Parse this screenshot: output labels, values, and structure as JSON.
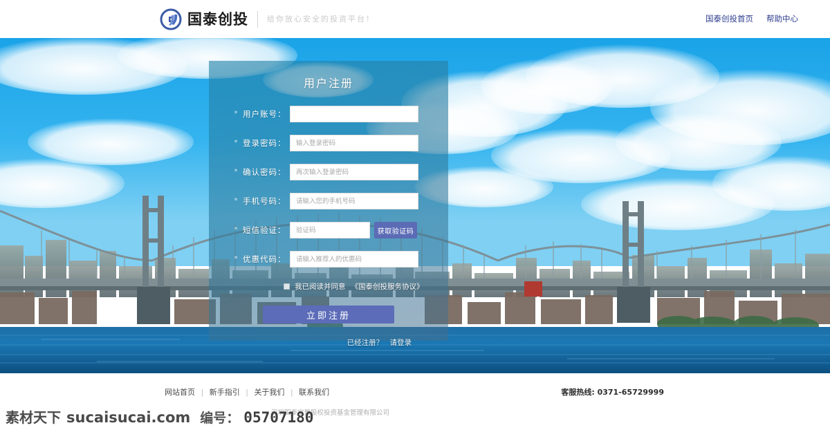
{
  "header": {
    "brand_name": "国泰创投",
    "tagline": "给你放心安全的投资平台！",
    "logo_icon": "gt-circle-logo-icon",
    "nav": [
      {
        "label": "国泰创投首页"
      },
      {
        "label": "帮助中心"
      }
    ]
  },
  "register": {
    "title": "用户注册",
    "required_mark": "*",
    "fields": [
      {
        "label": "用户账号：",
        "placeholder": "",
        "value": "",
        "type": "text"
      },
      {
        "label": "登录密码：",
        "placeholder": "输入登录密码",
        "value": "",
        "type": "password"
      },
      {
        "label": "确认密码：",
        "placeholder": "再次输入登录密码",
        "value": "",
        "type": "password"
      },
      {
        "label": "手机号码：",
        "placeholder": "请输入您的手机号码",
        "value": "",
        "type": "tel"
      },
      {
        "label": "短信验证：",
        "placeholder": "验证码",
        "value": "",
        "type": "text"
      },
      {
        "label": "优惠代码：",
        "placeholder": "请输入推荐人的优惠码",
        "value": "",
        "type": "text"
      }
    ],
    "get_code_button": "获取验证码",
    "agree_text": "我已阅读并同意",
    "agreement_link": "《国泰创投服务协议》",
    "submit_button": "立即注册",
    "already_registered": "已经注册？",
    "login_link": "请登录",
    "accent_color": "#5b6bb5",
    "panel_tint": "#2484aa"
  },
  "footer": {
    "links": [
      {
        "label": "网站首页"
      },
      {
        "label": "新手指引"
      },
      {
        "label": "关于我们"
      },
      {
        "label": "联系我们"
      }
    ],
    "divider": "|",
    "hotline_label": "客服热线:",
    "hotline_number": "0371-65729999",
    "copyright": "深圳国泰宝景股权投资基金管理有限公司"
  },
  "watermark": {
    "site_cn": "素材天下",
    "site_url": "sucaisucai.com",
    "id_label": "编号：",
    "id_number": "05707180"
  }
}
